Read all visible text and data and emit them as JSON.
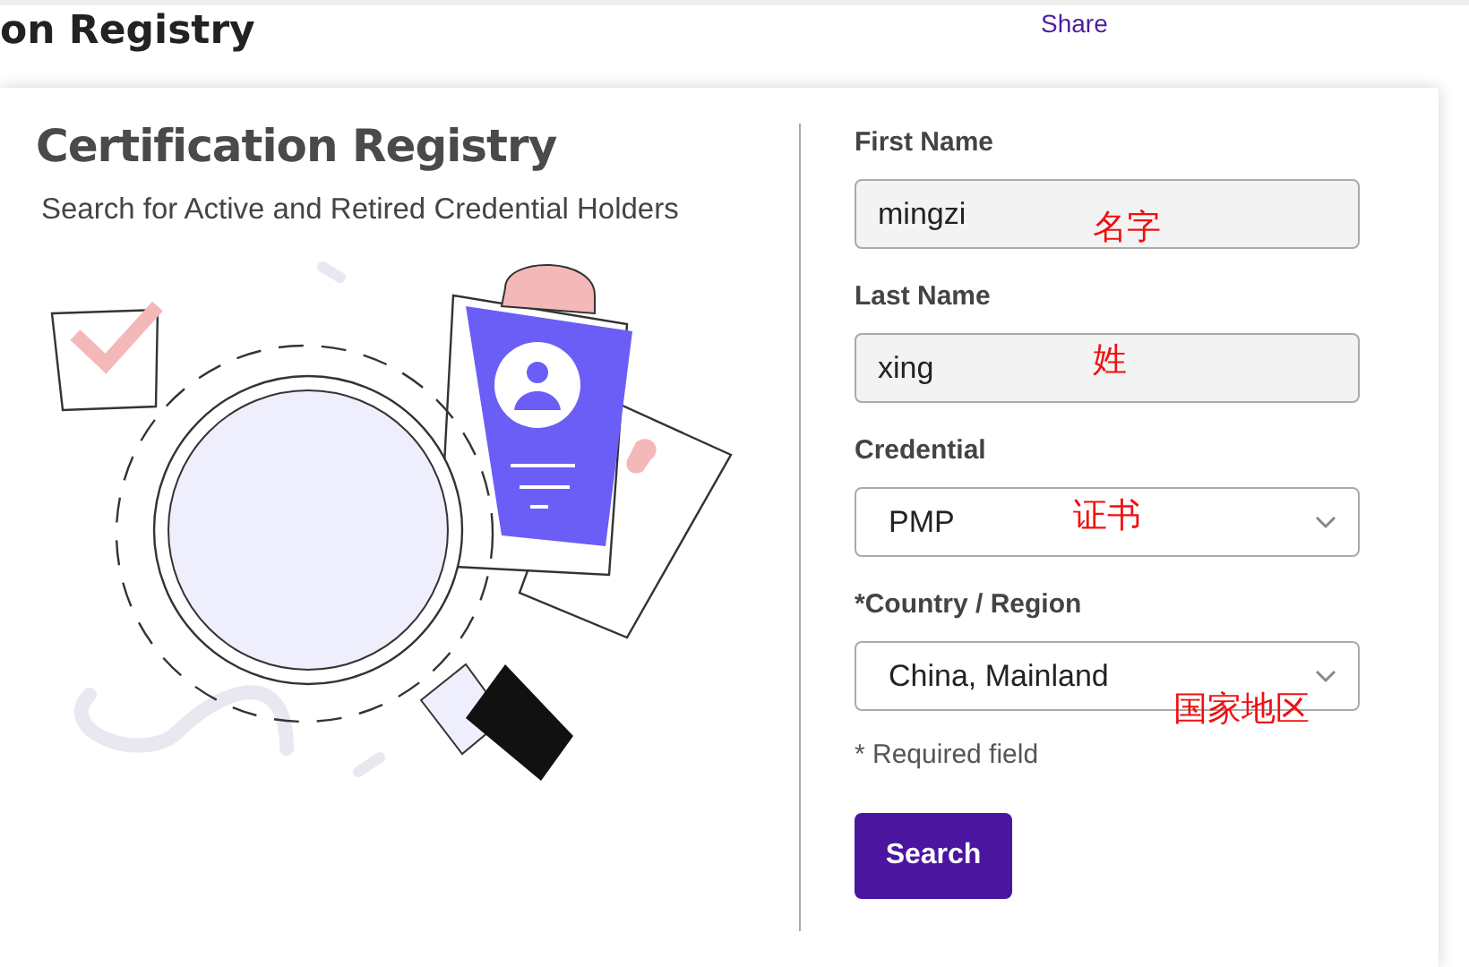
{
  "header": {
    "title": "on Registry",
    "link": "Share"
  },
  "card": {
    "title": "Certification Registry",
    "subtitle": "Search for Active and Retired Credential Holders"
  },
  "form": {
    "fields": [
      {
        "kind": "text",
        "label": "First Name",
        "value": "mingzi",
        "annotation": "名字"
      },
      {
        "kind": "text",
        "label": "Last Name",
        "value": "xing",
        "annotation": "姓"
      },
      {
        "kind": "select",
        "label": "Credential",
        "value": "PMP",
        "annotation": "证书"
      },
      {
        "kind": "select",
        "label": "*Country / Region",
        "value": "China, Mainland",
        "annotation": "国家地区"
      }
    ],
    "note": "* Required field",
    "button": "Search"
  }
}
